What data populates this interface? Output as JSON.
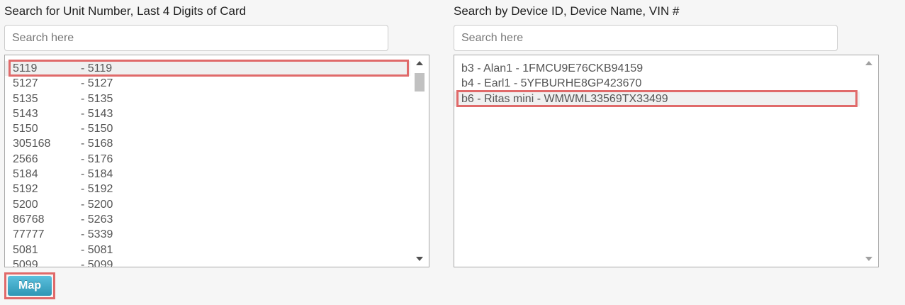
{
  "left_panel": {
    "label": "Search for Unit Number, Last 4 Digits of Card",
    "search_placeholder": "Search here",
    "items": [
      {
        "unit": "5119",
        "card": "- 5119"
      },
      {
        "unit": "5127",
        "card": "- 5127"
      },
      {
        "unit": "5135",
        "card": "- 5135"
      },
      {
        "unit": "5143",
        "card": "- 5143"
      },
      {
        "unit": "5150",
        "card": "- 5150"
      },
      {
        "unit": "305168",
        "card": "- 5168"
      },
      {
        "unit": "2566",
        "card": "- 5176"
      },
      {
        "unit": "5184",
        "card": "- 5184"
      },
      {
        "unit": "5192",
        "card": "- 5192"
      },
      {
        "unit": "5200",
        "card": "- 5200"
      },
      {
        "unit": "86768",
        "card": "- 5263"
      },
      {
        "unit": "77777",
        "card": "- 5339"
      },
      {
        "unit": "5081",
        "card": "- 5081"
      },
      {
        "unit": "5099",
        "card": "- 5099"
      }
    ]
  },
  "right_panel": {
    "label": "Search by Device ID, Device Name, VIN #",
    "search_placeholder": "Search here",
    "items": [
      {
        "text": "b3 - Alan1 - 1FMCU9E76CKB94159"
      },
      {
        "text": "b4 - Earl1 - 5YFBURHE8GP423670"
      },
      {
        "text": "b6 - Ritas mini - WMWML33569TX33499"
      }
    ]
  },
  "map_button": {
    "label": "Map"
  },
  "colors": {
    "highlight": "#e06a6a",
    "button_top": "#5bc0de",
    "button_bottom": "#2f96b4"
  },
  "icons": {
    "scroll_up": "triangle-up-icon",
    "scroll_down": "triangle-down-icon"
  }
}
